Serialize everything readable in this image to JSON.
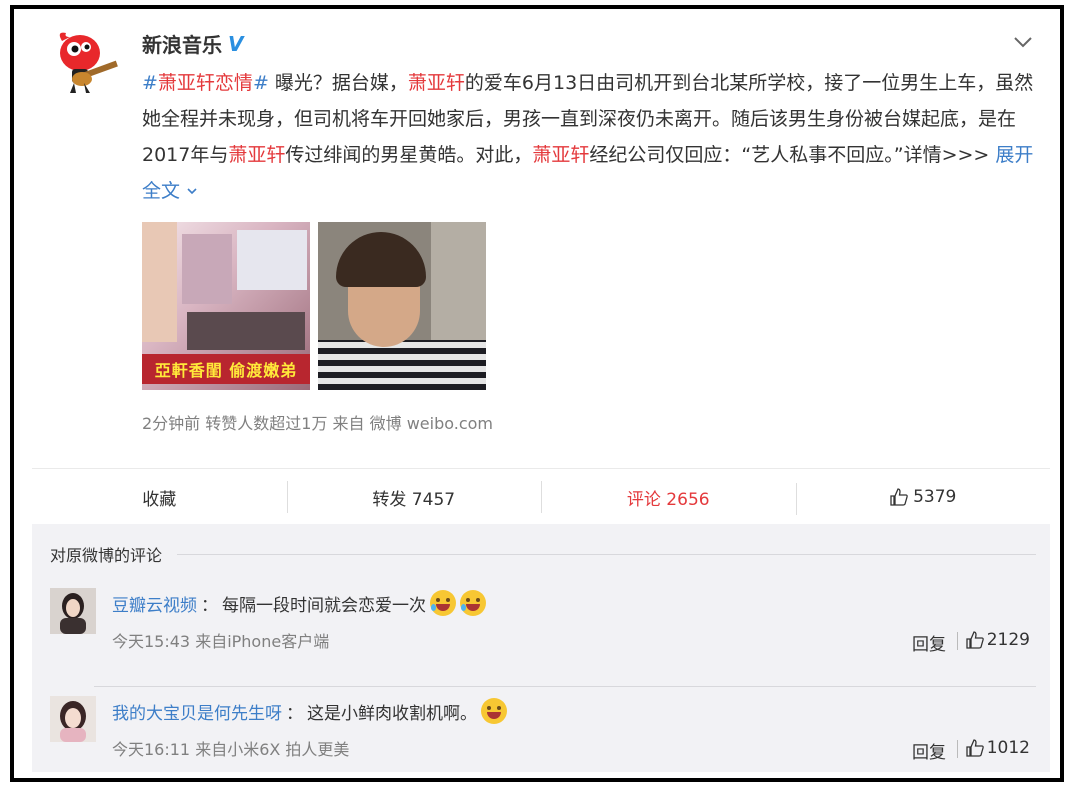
{
  "post": {
    "author": "新浪音乐",
    "verified_badge": "V",
    "topic": "#萧亚轩恋情#",
    "topic_prefix": "#",
    "topic_name": "萧亚轩恋情",
    "topic_suffix": "#",
    "text_1": " 曝光？据台媒，",
    "name": "萧亚轩",
    "text_2": "的爱车6月13日由司机开到台北某所学校，接了一位男生上车，虽然她全程并未现身，但司机将车开回她家后，男孩一直到深夜仍未离开。随后该男生身份被台媒起底，是在2017年与",
    "text_3": "传过绯闻的男星黄皓。对此，",
    "text_4": "经纪公司仅回应：“艺人私事不回应。”详情>>> ",
    "expand_label": "展开全文",
    "image1_caption": "亞軒香閨 偷渡嫩弟",
    "meta": "2分钟前  转赞人数超过1万  来自 微博 weibo.com"
  },
  "actions": {
    "favorite": "收藏",
    "repost": "转发 7457",
    "comment": "评论 2656",
    "like": "5379"
  },
  "comments_section": {
    "title": "对原微博的评论",
    "items": [
      {
        "user": "豆瓣云视频",
        "text": "每隔一段时间就会恋爱一次",
        "time": "今天15:43 来自iPhone客户端",
        "reply": "回复",
        "likes": "2129"
      },
      {
        "user": "我的大宝贝是何先生呀",
        "text": "这是小鲜肉收割机啊。",
        "time": "今天16:11 来自小米6X 拍人更美",
        "reply": "回复",
        "likes": "1012"
      }
    ]
  },
  "colors": {
    "accent_red": "#e4393c",
    "link_blue": "#3d7ec8",
    "verified_blue": "#2a8fe0"
  },
  "icons": [
    "sina-logo-icon",
    "verified-icon",
    "chevron-down-icon",
    "thumb-up-icon",
    "cry-laugh-emoji-icon",
    "laugh-emoji-icon"
  ]
}
